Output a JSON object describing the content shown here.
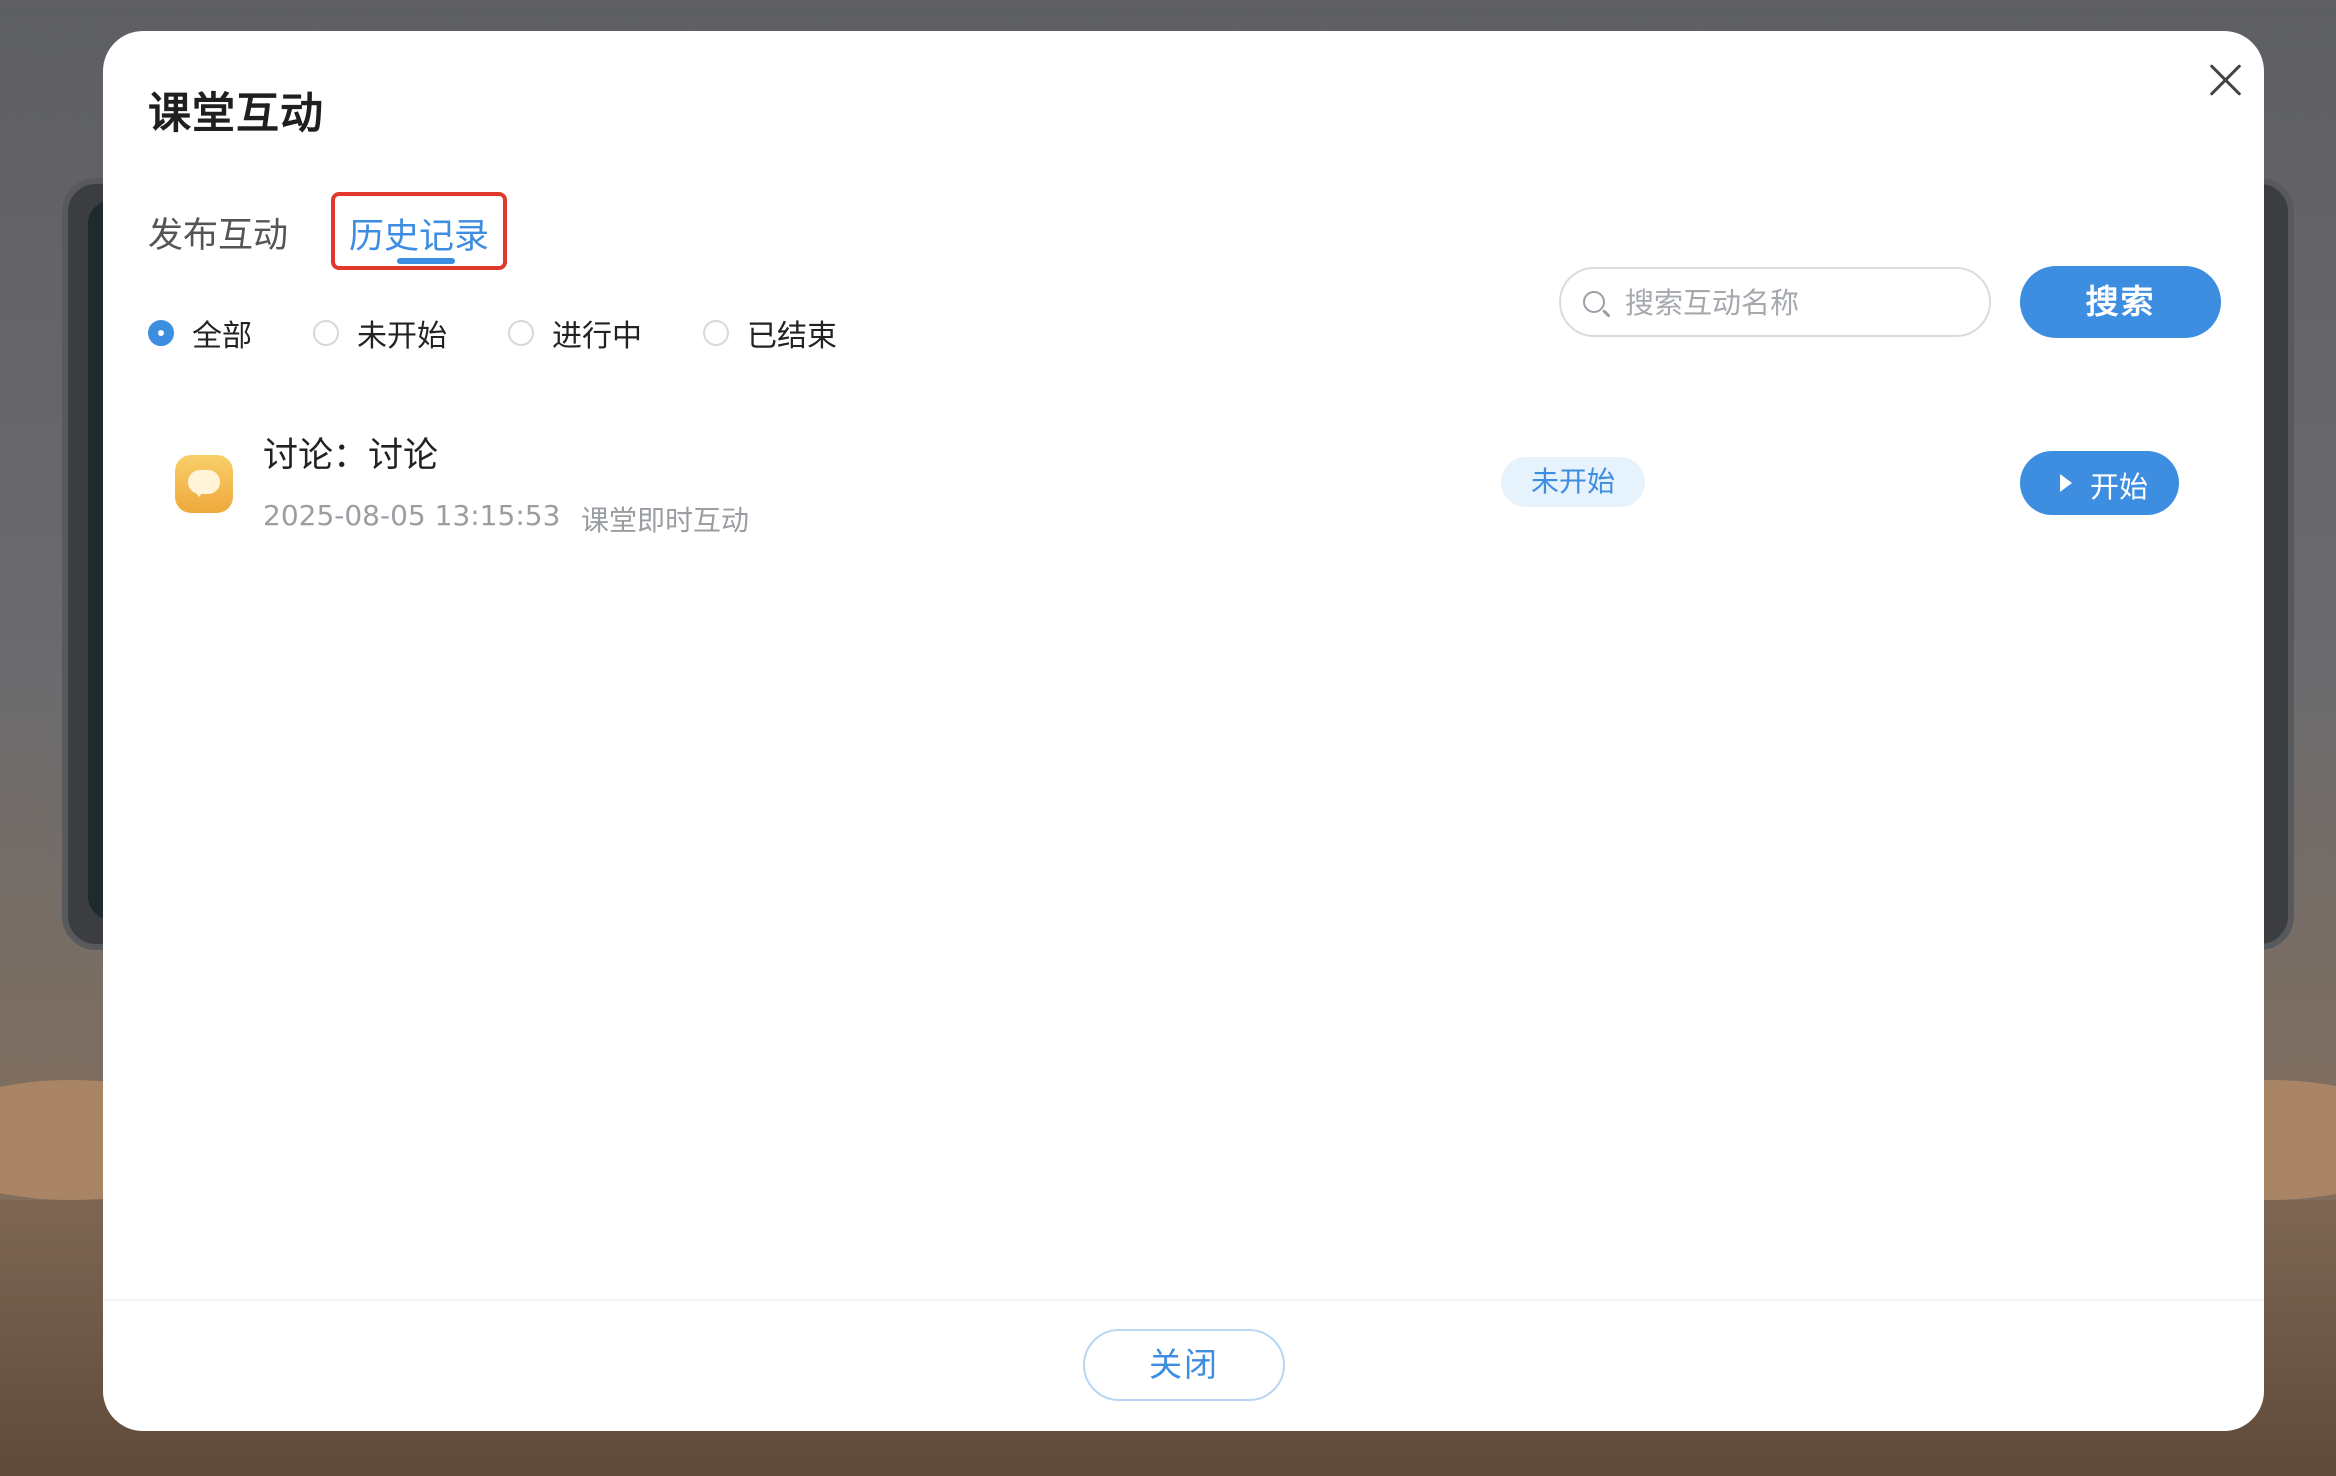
{
  "dialog": {
    "title": "课堂互动",
    "close_icon": "close-icon"
  },
  "tabs": [
    {
      "label": "发布互动",
      "active": false
    },
    {
      "label": "历史记录",
      "active": true
    }
  ],
  "filters": [
    {
      "label": "全部",
      "checked": true
    },
    {
      "label": "未开始",
      "checked": false
    },
    {
      "label": "进行中",
      "checked": false
    },
    {
      "label": "已结束",
      "checked": false
    }
  ],
  "search": {
    "placeholder": "搜索互动名称",
    "value": "",
    "button_label": "搜索"
  },
  "items": [
    {
      "title": "讨论：讨论",
      "time": "2025-08-05 13:15:53",
      "type": "课堂即时互动",
      "status": "未开始",
      "action_label": "开始"
    }
  ],
  "footer": {
    "close_label": "关闭"
  },
  "colors": {
    "accent": "#3d8de0",
    "highlight_border": "#e0392b",
    "status_bg": "#e6f2fc",
    "icon_gradient_top": "#f8cf6a",
    "icon_gradient_bottom": "#f0a93c"
  }
}
